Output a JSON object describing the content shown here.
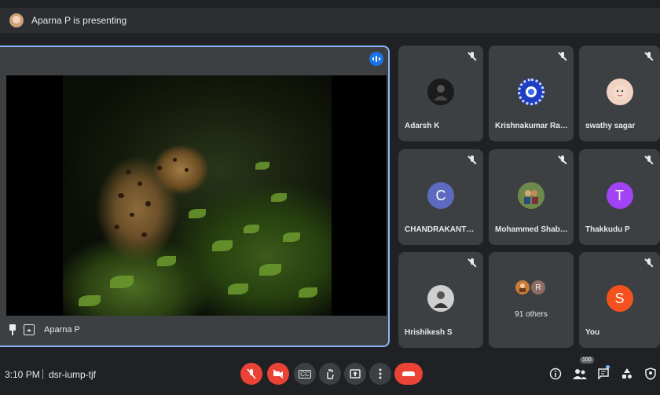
{
  "top_bar": {
    "presenting_text": "Aparna P is presenting"
  },
  "stage": {
    "presenter_name": "Aparna P"
  },
  "participants": [
    {
      "name": "Adarsh K",
      "avatar": "photo",
      "muted": true
    },
    {
      "name": "Krishnakumar Rama...",
      "avatar": "photo",
      "muted": true
    },
    {
      "name": "swathy sagar",
      "avatar": "photo",
      "muted": true
    },
    {
      "name": "CHANDRAKANTH J...",
      "avatar_letter": "C",
      "avatar_color": "#5c6bc0",
      "muted": true
    },
    {
      "name": "Mohammed Shabin p",
      "avatar": "photo",
      "muted": true
    },
    {
      "name": "Thakkudu P",
      "avatar_letter": "T",
      "avatar_color": "#a142f4",
      "muted": true
    },
    {
      "name": "Hrishikesh S",
      "avatar": "photo",
      "muted": true
    },
    {
      "others_label": "91 others",
      "avatar_letter": "R",
      "avatar_color": "#8d6e63"
    },
    {
      "name": "You",
      "avatar_letter": "S",
      "avatar_color": "#f4511e",
      "muted": true
    }
  ],
  "bottom_bar": {
    "time": "3:10 PM",
    "meeting_code": "dsr-iump-tjf",
    "people_count": "100",
    "controls": [
      {
        "name": "mic-off-icon",
        "state": "off"
      },
      {
        "name": "camera-off-icon",
        "state": "off"
      },
      {
        "name": "captions-icon",
        "label": "CC"
      },
      {
        "name": "raise-hand-icon"
      },
      {
        "name": "present-screen-icon"
      },
      {
        "name": "more-options-icon"
      },
      {
        "name": "end-call-icon"
      }
    ],
    "right_icons": [
      "info-icon",
      "people-icon",
      "chat-icon",
      "activities-icon",
      "host-controls-icon"
    ]
  },
  "colors": {
    "accent": "#8ab4f8",
    "danger": "#ea4335",
    "tile_bg": "#3c4043",
    "page_bg": "#202124"
  }
}
